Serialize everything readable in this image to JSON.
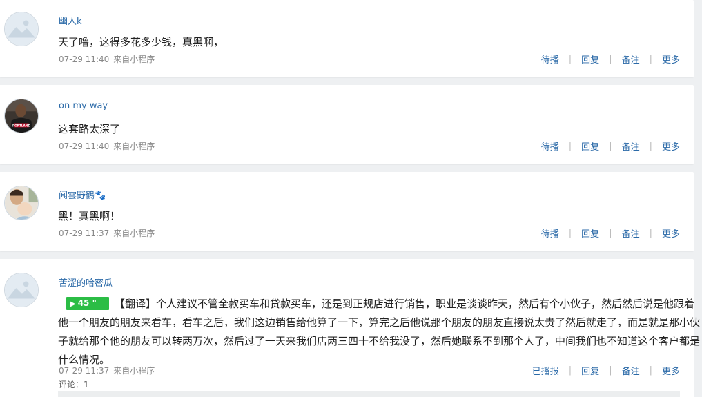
{
  "actions": {
    "broadcast_pending": "待播",
    "broadcast_done": "已播报",
    "reply": "回复",
    "note": "备注",
    "more": "更多",
    "sep": "|"
  },
  "posts": [
    {
      "username": "幽人k",
      "text": "天了噜，这得多花多少钱，真黑啊，",
      "time": "07-29 11:40",
      "source": "来自小程序",
      "avatar": "default-landscape-avatar"
    },
    {
      "username": "on my way",
      "text": "这套路太深了",
      "time": "07-29 11:40",
      "source": "来自小程序",
      "avatar": "basketball-player-avatar"
    },
    {
      "username": "闻雲野鶴🐾",
      "text": "黑！真黑啊！",
      "time": "07-29 11:37",
      "source": "来自小程序",
      "avatar": "baby-photo-avatar"
    },
    {
      "username": "苦涩的哈密瓜",
      "voice_duration": "45 \"",
      "text": "【翻译】个人建议不管全款买车和贷款买车，还是到正规店进行销售，职业是谈谈昨天，然后有个小伙子，然后然后说是他跟着他一个朋友的朋友来看车，看车之后，我们这边销售给他算了一下，算完之后他说那个朋友的朋友直接说太贵了然后就走了，而是就是那小伙子就给那个他的朋友可以转两万次，然后过了一天来我们店两三四十不给我没了，然后她联系不到那个人了，中间我们也不知道这个客户都是什么情况。",
      "time": "07-29 11:37",
      "source": "来自小程序",
      "avatar": "default-landscape-avatar",
      "comments": "评论：1"
    }
  ],
  "colors": {
    "link": "#2b6aa8",
    "voice": "#2bbd45",
    "background": "#eef0f2"
  }
}
